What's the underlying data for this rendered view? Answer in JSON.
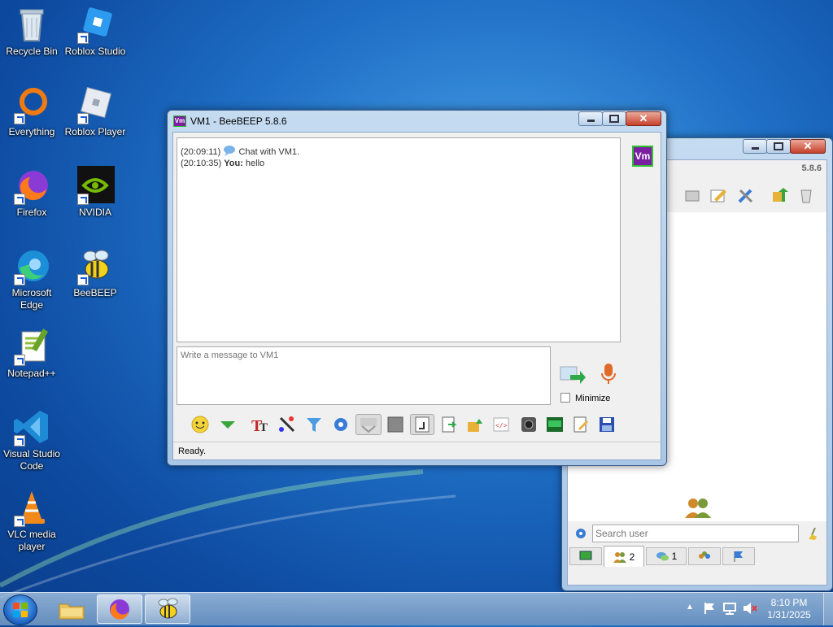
{
  "desktop": {
    "icons": [
      {
        "label": "Recycle Bin"
      },
      {
        "label": "Roblox Studio"
      },
      {
        "label": "Everything"
      },
      {
        "label": "Roblox Player"
      },
      {
        "label": "Firefox"
      },
      {
        "label": "NVIDIA"
      },
      {
        "label": "Microsoft Edge"
      },
      {
        "label": "BeeBEEP"
      },
      {
        "label": "Notepad++"
      },
      {
        "label": "Visual Studio Code"
      },
      {
        "label": "VLC media player"
      }
    ]
  },
  "chat_window": {
    "title": "VM1 - BeeBEEP 5.8.6",
    "messages": [
      {
        "time": "(20:09:11)",
        "sender": "",
        "text": "Chat with VM1."
      },
      {
        "time": "(20:10:35)",
        "sender": "You:",
        "text": "hello"
      }
    ],
    "input_placeholder": "Write a message to VM1",
    "minimize_label": "Minimize",
    "avatar_label": "Vm",
    "status": "Ready."
  },
  "main_window": {
    "version": "5.8.6",
    "search_placeholder": "Search user",
    "tabs": [
      {
        "label": ""
      },
      {
        "label": "2"
      },
      {
        "label": "1"
      },
      {
        "label": ""
      },
      {
        "label": ""
      }
    ]
  },
  "taskbar": {
    "time": "8:10 PM",
    "date": "1/31/2025"
  },
  "colors": {
    "accent": "#1f6fc6",
    "avatar_bg": "#7a1fa2",
    "avatar_border": "#2fbf2f"
  }
}
